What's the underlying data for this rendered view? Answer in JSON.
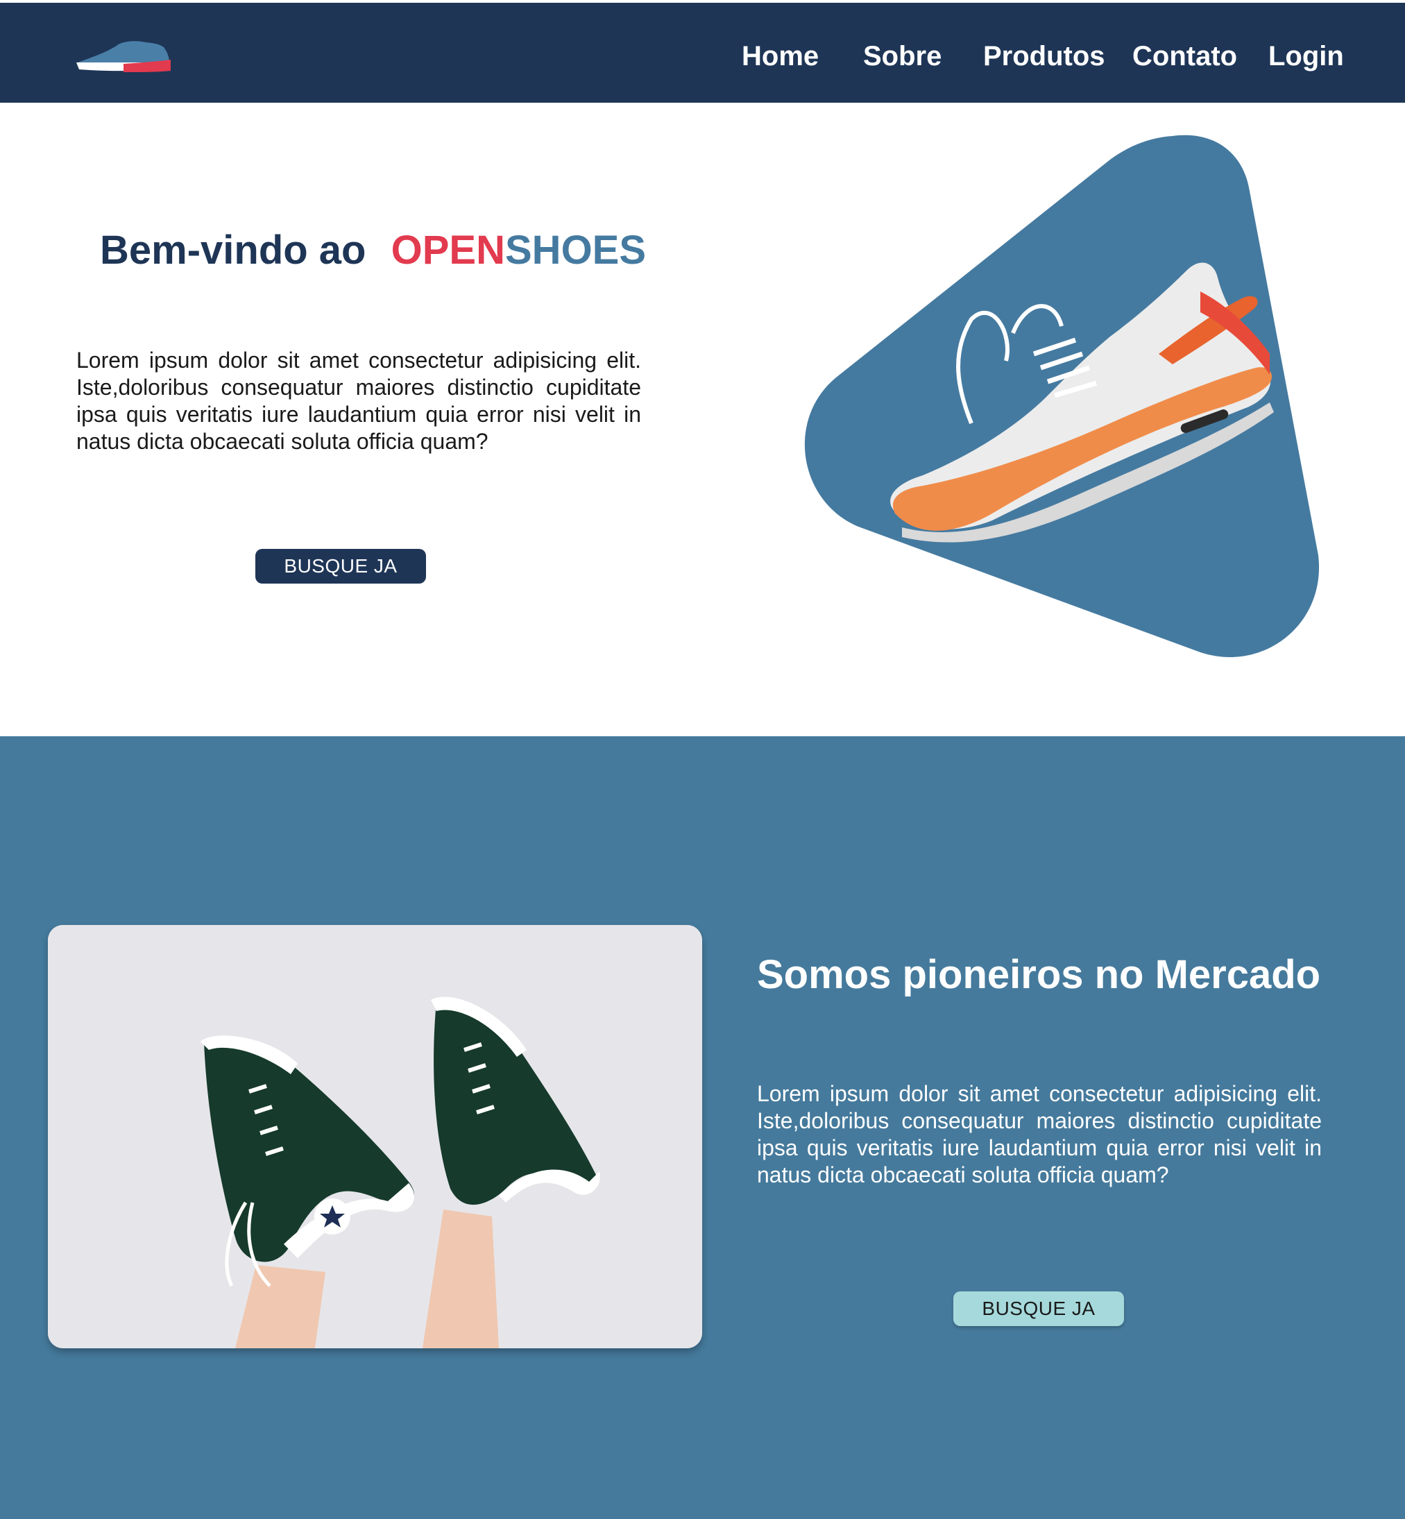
{
  "nav": {
    "links": [
      "Home",
      "Sobre",
      "Produtos",
      "Contato",
      "Login"
    ]
  },
  "hero": {
    "title_prefix": "Bem-vindo ao",
    "brand_open": "OPEN",
    "brand_shoes": "SHOES",
    "paragraph": "Lorem ipsum dolor sit amet consectetur adipisicing elit. Iste,doloribus consequatur maiores distinctio cupiditate ipsa quis veritatis iure laudantium quia error nisi velit in natus dicta obcaecati soluta officia quam?",
    "button_label": "BUSQUE JA"
  },
  "about": {
    "title": "Somos pioneiros no Mercado",
    "paragraph": "Lorem ipsum dolor sit amet consectetur adipisicing elit. Iste,doloribus consequatur maiores distinctio cupiditate ipsa quis veritatis iure laudantium quia error nisi velit in natus dicta obcaecati soluta officia quam?",
    "button_label": "BUSQUE JA"
  },
  "colors": {
    "navbar": "#1e3556",
    "brand_red": "#e23a4e",
    "brand_blue": "#457aa0",
    "section_bg": "#457a9c",
    "button_dark": "#1e3556",
    "button_light": "#a6d9db"
  },
  "icons": [
    "shoe-logo-icon"
  ]
}
